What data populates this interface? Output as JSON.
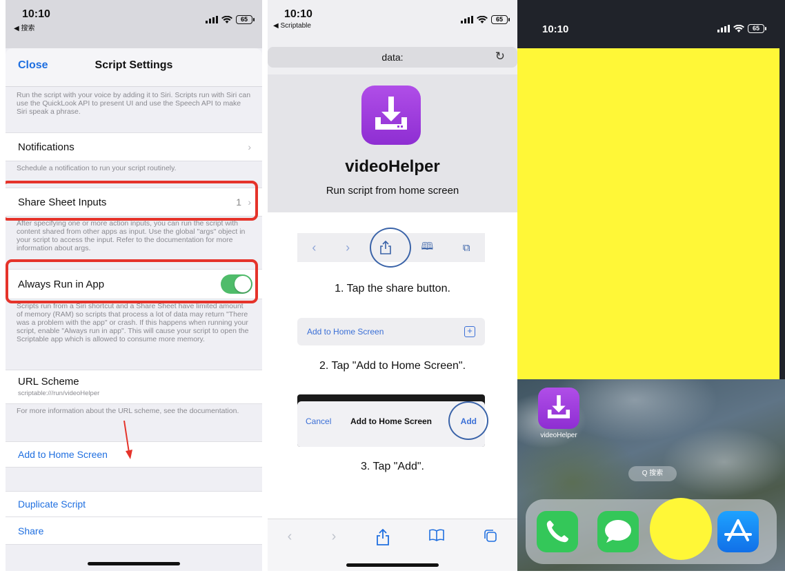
{
  "left_panel": {
    "status": {
      "time": "10:10",
      "back_app": "◀ 搜索",
      "battery": "65"
    },
    "nav": {
      "close_label": "Close",
      "title": "Script Settings"
    },
    "siri_note": "Run the script with your voice by adding it to Siri. Scripts run with Siri can use the QuickLook API to present UI and use the Speech API to make Siri speak a phrase.",
    "notifications": {
      "label": "Notifications",
      "note": "Schedule a notification to run your script routinely."
    },
    "share_sheet": {
      "label": "Share Sheet Inputs",
      "value": "1",
      "note": "After specifying one or more action inputs, you can run the script with content shared from other apps as input. Use the global \"args\" object in your script to access the input. Refer to the documentation for more information about args."
    },
    "always_run": {
      "label": "Always Run in App",
      "enabled": true,
      "note": "Scripts run from a Siri shortcut and a Share Sheet have limited amount of memory (RAM) so scripts that process a lot of data may return \"There was a problem with the app\" or crash. If this happens when running your script, enable \"Always run in app\". This will cause your script to open the Scriptable app which is allowed to consume more memory."
    },
    "url_scheme": {
      "label": "URL Scheme",
      "value": "scriptable:///run/videoHelper",
      "note": "For more information about the URL scheme, see the documentation."
    },
    "add_home_label": "Add to Home Screen",
    "duplicate_label": "Duplicate Script",
    "share_label": "Share",
    "colors": {
      "accent": "#1f6fe0",
      "highlight": "#e5332a",
      "toggle_on": "#4fbc6a"
    }
  },
  "middle_panel": {
    "status": {
      "time": "10:10",
      "back_app": "◀ Scriptable",
      "battery": "65"
    },
    "url": "data:",
    "app_name": "videoHelper",
    "subtitle": "Run script from home screen",
    "step1": "1. Tap the share button.",
    "demo_add_label": "Add to Home Screen",
    "step2": "2. Tap \"Add to Home Screen\".",
    "demo_sheet": {
      "cancel": "Cancel",
      "title": "Add to Home Screen",
      "add": "Add"
    },
    "step3": "3. Tap \"Add\"."
  },
  "right_panel": {
    "status": {
      "time": "10:10",
      "battery": "65"
    },
    "app_label": "videoHelper",
    "search_label": "Q 搜索",
    "dock_apps": [
      "phone-icon",
      "messages-icon",
      "redacted",
      "app-store-icon"
    ],
    "colors": {
      "redaction": "#fff737"
    }
  }
}
